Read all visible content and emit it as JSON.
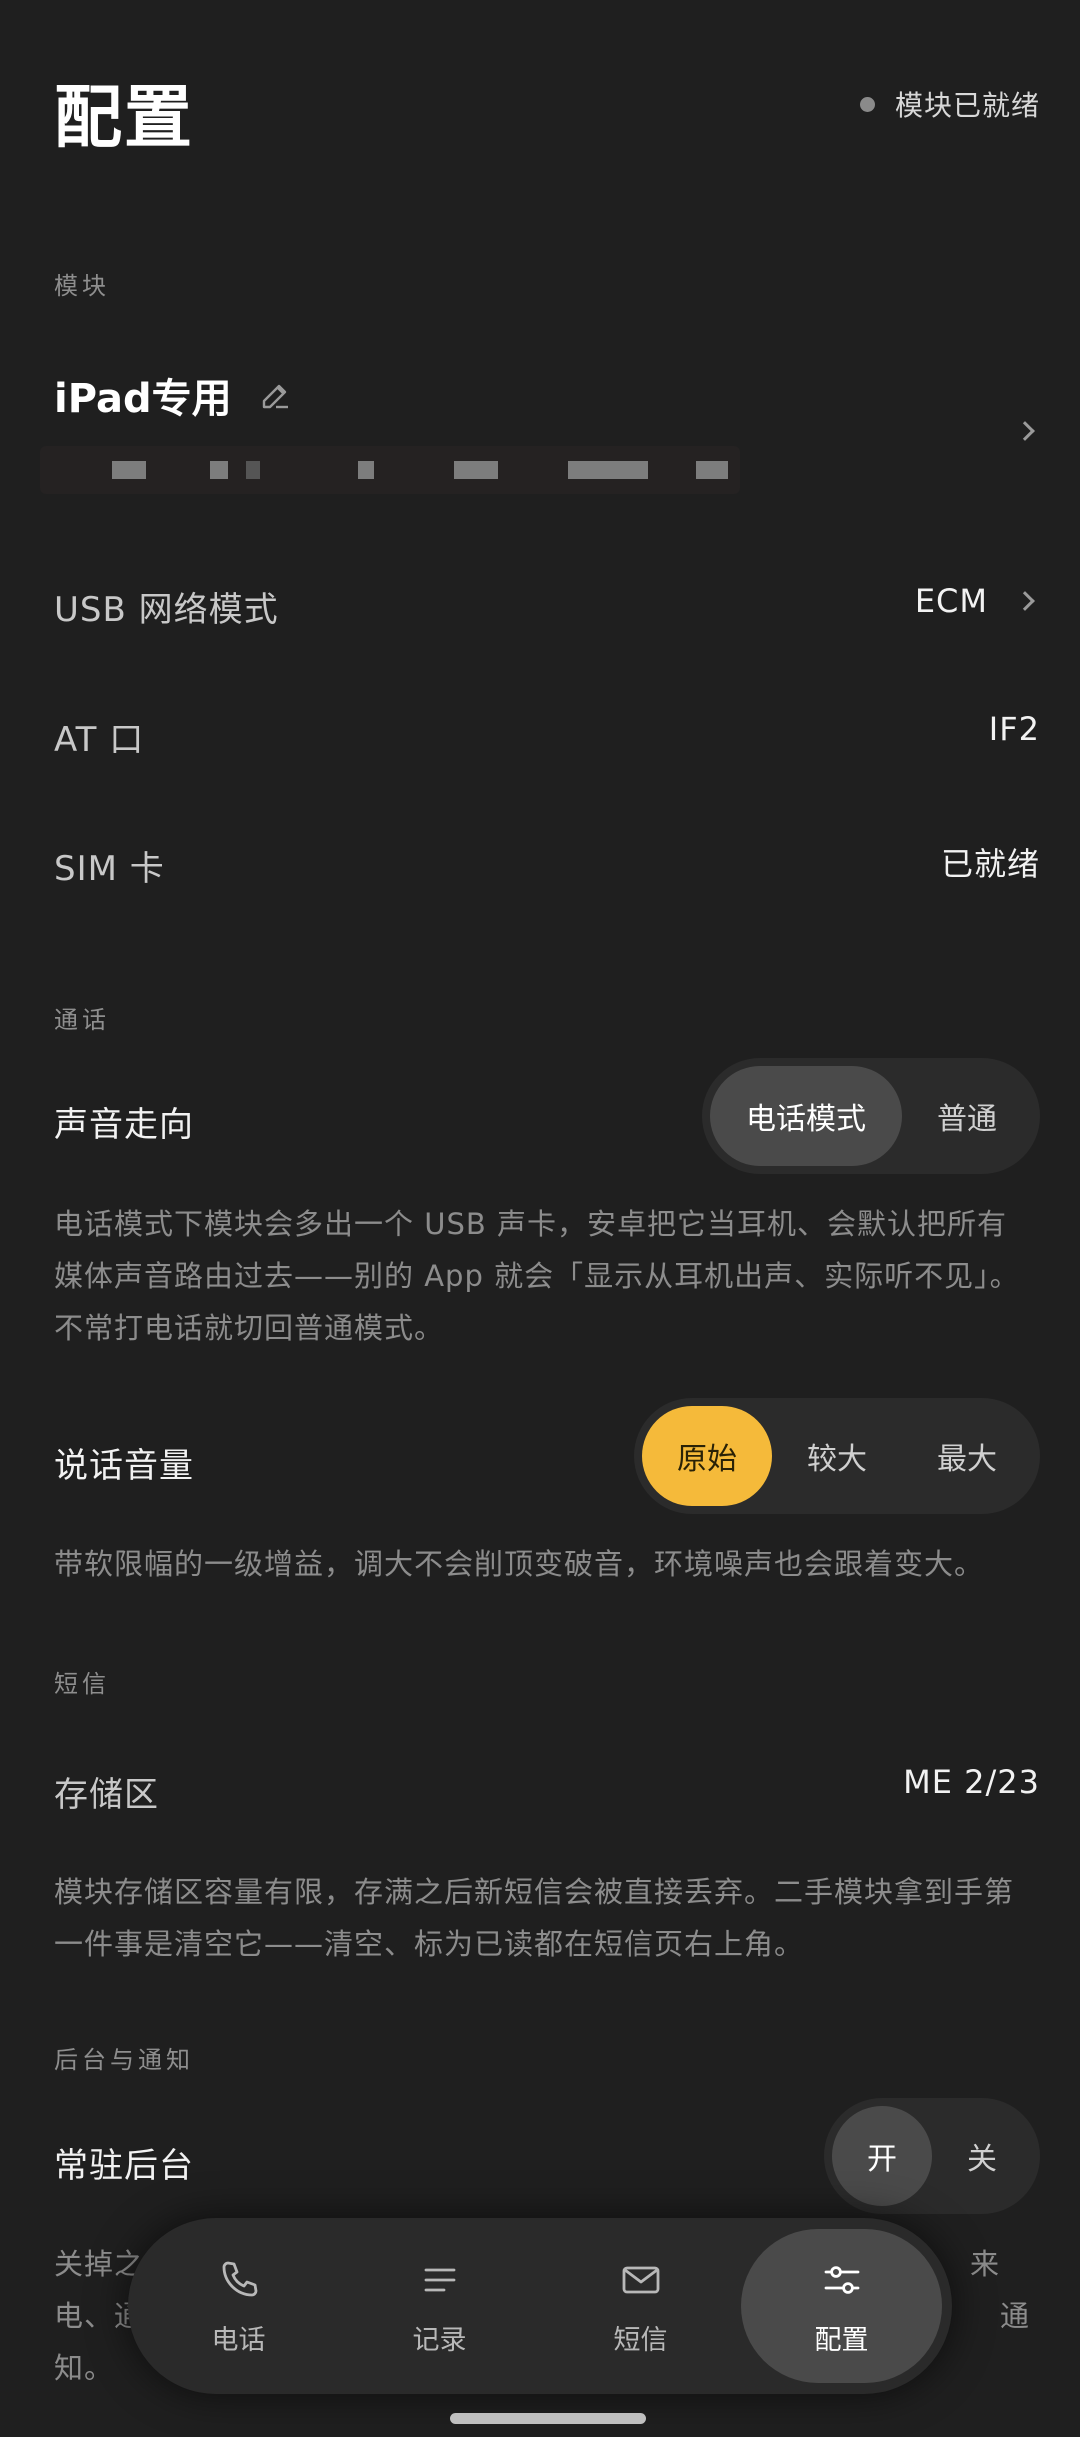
{
  "header": {
    "title": "配置",
    "status_text": "模块已就绪"
  },
  "sections": {
    "module": "模块",
    "call": "通话",
    "sms": "短信",
    "background": "后台与通知"
  },
  "module": {
    "name": "iPad专用",
    "usb_mode_label": "USB 网络模式",
    "usb_mode_value": "ECM",
    "at_port_label": "AT 口",
    "at_port_value": "IF2",
    "sim_label": "SIM 卡",
    "sim_value": "已就绪"
  },
  "call": {
    "audio_route_label": "声音走向",
    "audio_route_options": [
      "电话模式",
      "普通"
    ],
    "audio_route_selected": "电话模式",
    "audio_route_desc_lines": [
      "电话模式下模块会多出一个 USB 声卡，安卓把它当耳机、会默认把所有",
      "媒体声音路由过去——别的 App 就会「显示从耳机出声、实际听不见」。",
      "不常打电话就切回普通模式。"
    ],
    "volume_label": "说话音量",
    "volume_options": [
      "原始",
      "较大",
      "最大"
    ],
    "volume_selected": "原始",
    "volume_desc": "带软限幅的一级增益，调大不会削顶变破音，环境噪声也会跟着变大。"
  },
  "sms": {
    "storage_label": "存储区",
    "storage_value": "ME 2/23",
    "storage_desc_lines": [
      "模块存储区容量有限，存满之后新短信会被直接丢弃。二手模块拿到手第",
      "一件事是清空它——清空、标为已读都在短信页右上角。"
    ]
  },
  "background": {
    "persist_label": "常驻后台",
    "persist_options": [
      "开",
      "关"
    ],
    "persist_selected": "开",
    "desc_lines_partial": [
      "关掉之",
      "来",
      "电、通",
      "通",
      "知。"
    ]
  },
  "nav": {
    "items": [
      {
        "label": "电话",
        "icon": "phone-icon"
      },
      {
        "label": "记录",
        "icon": "list-icon"
      },
      {
        "label": "短信",
        "icon": "mail-icon"
      },
      {
        "label": "配置",
        "icon": "sliders-icon"
      }
    ],
    "active": "配置"
  },
  "colors": {
    "background": "#1f1f1f",
    "accent_yellow": "#f5ba3a",
    "segment_bg": "#2b2b2b",
    "selected_gray": "#4a4a4a"
  }
}
